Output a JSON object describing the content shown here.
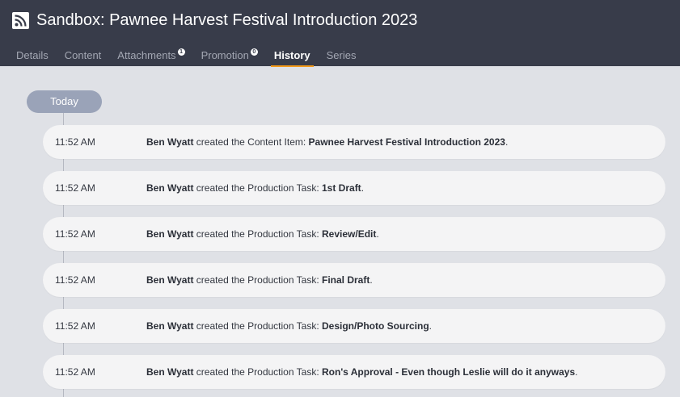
{
  "header": {
    "title": "Sandbox: Pawnee Harvest Festival Introduction 2023",
    "icon": "rss-icon",
    "background": "#383c4a",
    "accent": "#f49a1a"
  },
  "tabs": [
    {
      "label": "Details",
      "badge": ""
    },
    {
      "label": "Content",
      "badge": ""
    },
    {
      "label": "Attachments",
      "badge": "1"
    },
    {
      "label": "Promotion",
      "badge": "0"
    },
    {
      "label": "History",
      "badge": ""
    },
    {
      "label": "Series",
      "badge": ""
    }
  ],
  "active_tab": "History",
  "timeline": {
    "group_label": "Today",
    "entries": [
      {
        "time": "11:52 AM",
        "user": "Ben Wyatt",
        "action": " created the Content Item: ",
        "target": "Pawnee Harvest Festival Introduction 2023",
        "suffix": "."
      },
      {
        "time": "11:52 AM",
        "user": "Ben Wyatt",
        "action": " created the Production Task: ",
        "target": "1st Draft",
        "suffix": "."
      },
      {
        "time": "11:52 AM",
        "user": "Ben Wyatt",
        "action": " created the Production Task: ",
        "target": "Review/Edit",
        "suffix": "."
      },
      {
        "time": "11:52 AM",
        "user": "Ben Wyatt",
        "action": " created the Production Task: ",
        "target": "Final Draft",
        "suffix": "."
      },
      {
        "time": "11:52 AM",
        "user": "Ben Wyatt",
        "action": " created the Production Task: ",
        "target": "Design/Photo Sourcing",
        "suffix": "."
      },
      {
        "time": "11:52 AM",
        "user": "Ben Wyatt",
        "action": " created the Production Task: ",
        "target": "Ron's Approval - Even though Leslie will do it anyways",
        "suffix": "."
      }
    ]
  }
}
